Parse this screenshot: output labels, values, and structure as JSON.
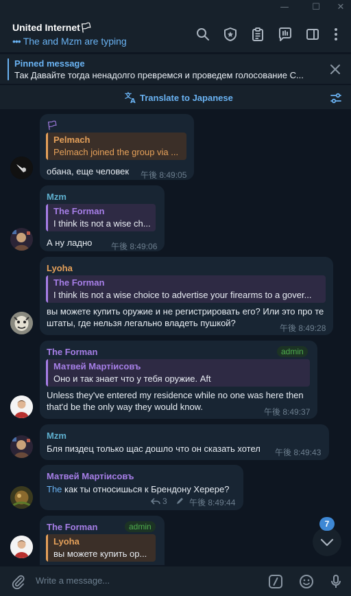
{
  "window": {
    "minimize": "—",
    "maximize": "☐",
    "close": "✕"
  },
  "header": {
    "title": "United Internet🏳",
    "typing_indicator": "•••",
    "typing": "The and Mzm are typing"
  },
  "pinned": {
    "title": "Pinned message",
    "text": "Так Давайте тогда ненадолго превремся и проведем голосование  C..."
  },
  "translate": {
    "label": "Translate to Japanese"
  },
  "colors": {
    "accent": "#6ab3f3",
    "orange": "#e6a15a",
    "purple": "#a77fe8",
    "teal": "#5fb0cf",
    "admin_green": "#4fae4e"
  },
  "messages": [
    {
      "sender": "🏳",
      "reply_name": "Pelmach",
      "reply_text": "Pelmach joined the group via ...",
      "text": "обана, еще человек",
      "time": "午後 8:49:05"
    },
    {
      "sender": "Mzm",
      "reply_name": "The Forman",
      "reply_text": "I think its not a wise ch...",
      "text": "А ну ладно",
      "time": "午後 8:49:06"
    },
    {
      "sender": "Lyoha",
      "reply_name": "The Forman",
      "reply_text": "I think its not a wise choice to advertise your firearms to a gover...",
      "text": "вы можете купить оружие и не регистрировать его? Или это про те штаты, где нельзя легально владеть пушкой?",
      "time": "午後 8:49:28"
    },
    {
      "sender": "The Forman",
      "badge": "admin",
      "reply_name": "Матвей Мартiисовъ",
      "reply_text": "Оно и так знает что у тебя оружие. Aft",
      "text": "Unless they've entered my residence while no one was here then that'd be the only way they would know.",
      "time": "午後 8:49:37"
    },
    {
      "sender": "Mzm",
      "text": "Бля пиздец только щас дошло что он сказать хотел",
      "time": "午後 8:49:43"
    },
    {
      "sender": "Матвей Мартiисовъ",
      "mention": "The",
      "text": " как ты относишься к Брендону Херере?",
      "replies": "3",
      "time": "午後 8:49:44"
    },
    {
      "sender": "The Forman",
      "badge": "admin",
      "reply_name": "Lyoha",
      "reply_text": "вы можете купить ор..."
    }
  ],
  "scroll": {
    "unread": "7"
  },
  "composer": {
    "placeholder": "Write a message..."
  }
}
